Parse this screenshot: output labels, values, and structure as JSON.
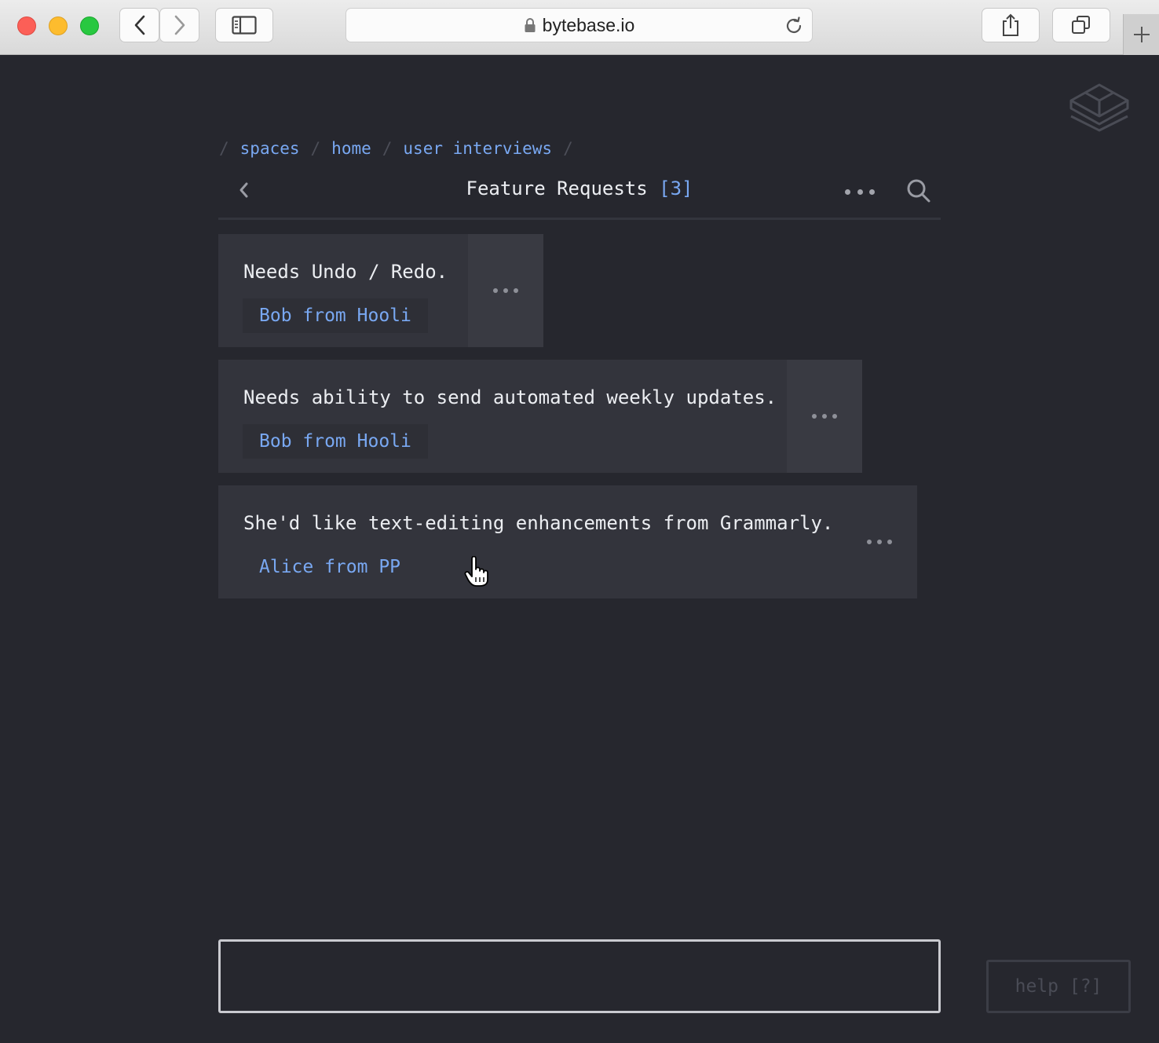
{
  "browser": {
    "url": "bytebase.io"
  },
  "breadcrumb": {
    "items": [
      "spaces",
      "home",
      "user interviews"
    ],
    "separator": "/"
  },
  "header": {
    "title": "Feature Requests",
    "count": "[3]"
  },
  "cards": [
    {
      "text": "Needs Undo / Redo.",
      "tag": "Bob from Hooli"
    },
    {
      "text": "Needs ability to send automated weekly updates.",
      "tag": "Bob from Hooli"
    },
    {
      "text": "She'd like text-editing enhancements from Grammarly.",
      "tag": "Alice from PP"
    }
  ],
  "input": {
    "value": "",
    "placeholder": ""
  },
  "help": {
    "label": "help [?]"
  },
  "colors": {
    "background": "#26272e",
    "card": "#33343c",
    "accent": "#79a8f2",
    "text": "#eceef2"
  }
}
